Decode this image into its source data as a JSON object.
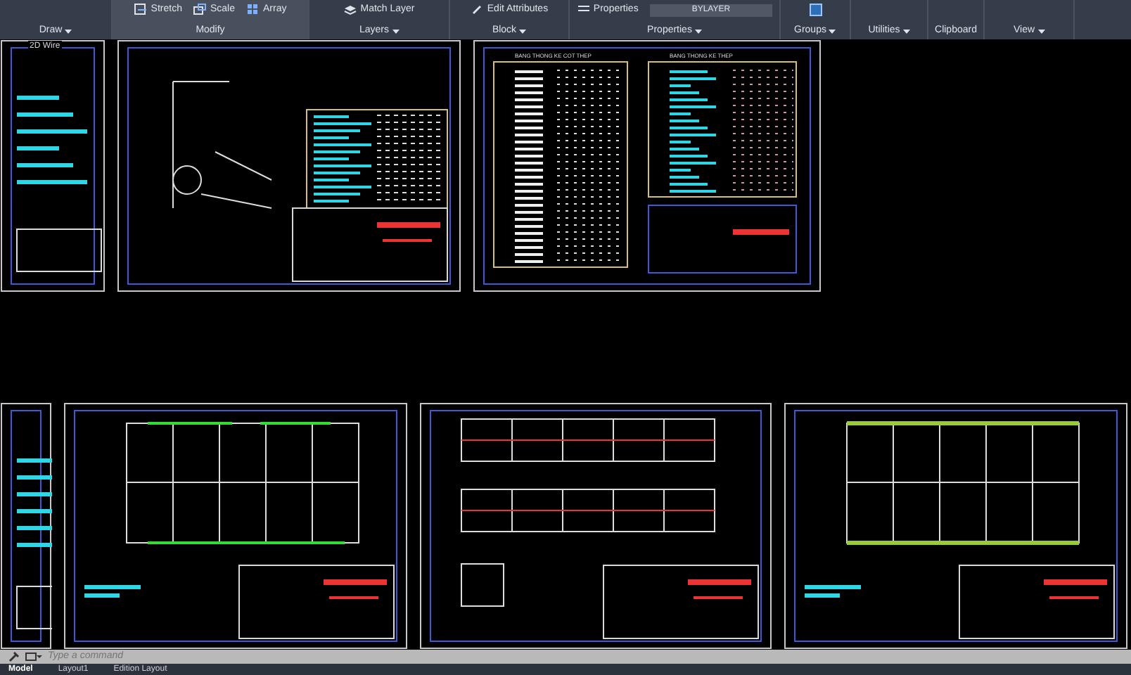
{
  "ribbon": {
    "panels": [
      {
        "label": "Draw",
        "caret": true,
        "highlighted": false
      },
      {
        "label": "Modify",
        "caret": false,
        "highlighted": true,
        "tools": [
          {
            "label": "Stretch",
            "kind": "stretch"
          },
          {
            "label": "Scale",
            "kind": "scale"
          },
          {
            "label": "Array",
            "kind": "array"
          }
        ]
      },
      {
        "label": "Layers",
        "caret": true,
        "highlighted": false,
        "tools": [
          {
            "label": "Match Layer",
            "kind": "layer"
          }
        ]
      },
      {
        "label": "Block",
        "caret": true,
        "highlighted": false,
        "tools": [
          {
            "label": "Edit Attributes",
            "kind": "attributes"
          }
        ]
      },
      {
        "label": "Properties",
        "caret": true,
        "highlighted": false,
        "tools": [
          {
            "label": "Properties",
            "kind": "properties"
          },
          {
            "label": "BYLAYER",
            "kind": "dropdown"
          }
        ]
      },
      {
        "label": "Groups",
        "caret": true,
        "highlighted": false,
        "tools": [
          {
            "kind": "group"
          }
        ]
      },
      {
        "label": "Utilities",
        "caret": true,
        "highlighted": false
      },
      {
        "label": "Clipboard",
        "caret": false,
        "highlighted": false
      },
      {
        "label": "View",
        "caret": true,
        "highlighted": false
      }
    ]
  },
  "viewport": {
    "label": "2D Wire",
    "sheets_top": [
      {
        "kind": "detail"
      },
      {
        "kind": "detail-table"
      },
      {
        "kind": "tables",
        "titles": [
          "BANG THONG KE COT THEP",
          "BANG THONG KE THEP"
        ]
      }
    ],
    "sheets_bottom": [
      {
        "kind": "partial"
      },
      {
        "kind": "plan"
      },
      {
        "kind": "elevations"
      },
      {
        "kind": "truss-plan"
      }
    ]
  },
  "command_line": {
    "placeholder": "Type a command"
  },
  "layout_tabs": [
    {
      "label": "Model",
      "selected": true
    },
    {
      "label": "Layout1",
      "selected": false
    },
    {
      "label": "Edition Layout",
      "selected": false
    }
  ]
}
